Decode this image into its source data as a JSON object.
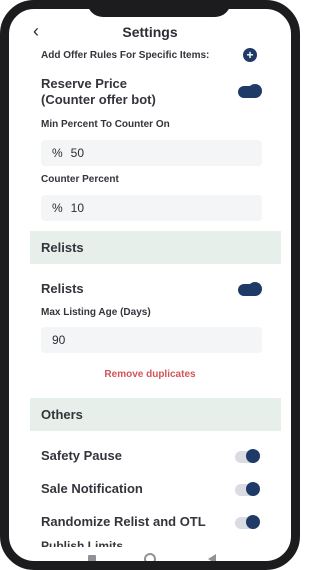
{
  "header": {
    "title": "Settings",
    "back_icon": "chevron-left-icon",
    "back_glyph": "‹"
  },
  "offer_rules": {
    "label": "Add Offer Rules For Specific Items:",
    "add_glyph": "+"
  },
  "reserve_price": {
    "label_line1": "Reserve Price",
    "label_line2": "(Counter offer bot)",
    "enabled": true
  },
  "min_percent": {
    "label": "Min Percent To Counter On",
    "prefix": "%",
    "value": "50"
  },
  "counter_percent": {
    "label": "Counter Percent",
    "prefix": "%",
    "value": "10"
  },
  "relists_section": {
    "title": "Relists"
  },
  "relists": {
    "label": "Relists",
    "enabled": true
  },
  "max_listing_age": {
    "label": "Max Listing Age (Days)",
    "value": "90"
  },
  "remove_duplicates": {
    "label": "Remove duplicates",
    "color": "#d0555b"
  },
  "others_section": {
    "title": "Others"
  },
  "others": [
    {
      "label": "Safety Pause",
      "enabled": false
    },
    {
      "label": "Sale Notification",
      "enabled": false
    },
    {
      "label": "Randomize Relist and OTL",
      "enabled": false
    }
  ],
  "cutoff_label": "Publish Limits",
  "colors": {
    "accent": "#1f3a67",
    "section_bg": "#e6efea",
    "field_bg": "#f3f5f7",
    "link": "#d0555b"
  },
  "navbar": {
    "icons": [
      "recent-apps-icon",
      "home-icon",
      "back-icon"
    ]
  }
}
